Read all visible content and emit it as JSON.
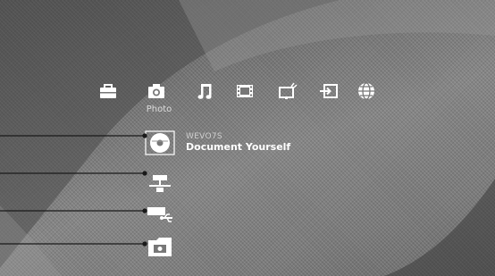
{
  "categories": [
    {
      "icon": "toolbox-icon",
      "label": ""
    },
    {
      "icon": "camera-icon",
      "label": "Photo"
    },
    {
      "icon": "music-note-icon",
      "label": ""
    },
    {
      "icon": "film-strip-icon",
      "label": ""
    },
    {
      "icon": "tv-icon",
      "label": ""
    },
    {
      "icon": "input-icon",
      "label": ""
    },
    {
      "icon": "globe-icon",
      "label": ""
    }
  ],
  "selected_category": "Photo",
  "items": [
    {
      "icon": "disc-icon",
      "subtitle": "WEVO7S",
      "title": "Document Yourself"
    },
    {
      "icon": "network-server-icon"
    },
    {
      "icon": "usb-device-icon"
    },
    {
      "icon": "photo-folder-icon"
    }
  ],
  "colors": {
    "icon": "#ffffff",
    "callout_line": "#1a1a1a",
    "text": "#ffffff"
  }
}
